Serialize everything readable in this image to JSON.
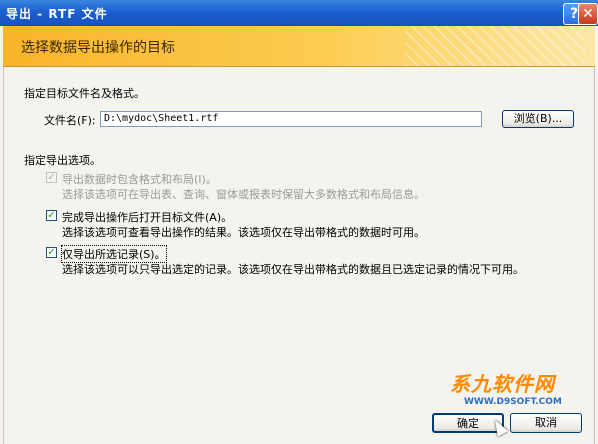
{
  "window": {
    "title": "导出 - RTF 文件",
    "help_label": "?",
    "close_label": "✕"
  },
  "banner": {
    "title": "选择数据导出操作的目标"
  },
  "file": {
    "section_label": "指定目标文件名及格式。",
    "name_label": "文件名(F):",
    "name_value": "D:\\mydoc\\Sheet1.rtf",
    "browse_label": "浏览(B)..."
  },
  "options": {
    "section_label": "指定导出选项。",
    "items": [
      {
        "label": "导出数据时包含格式和布局(I)。",
        "desc": "选择该选项可在导出表、查询、窗体或报表时保留大多数格式和布局信息。",
        "checked": true,
        "enabled": false
      },
      {
        "label": "完成导出操作后打开目标文件(A)。",
        "desc": "选择该选项可查看导出操作的结果。该选项仅在导出带格式的数据时可用。",
        "checked": true,
        "enabled": true
      },
      {
        "label": "仅导出所选记录(S)。",
        "desc": "选择该选项可以只导出选定的记录。该选项仅在导出带格式的数据且已选定记录的情况下可用。",
        "checked": true,
        "enabled": true
      }
    ]
  },
  "footer": {
    "ok_label": "确定",
    "cancel_label": "取消"
  },
  "watermark": {
    "brand": "系九软件网",
    "url": "WWW.D9SOFT.COM"
  }
}
